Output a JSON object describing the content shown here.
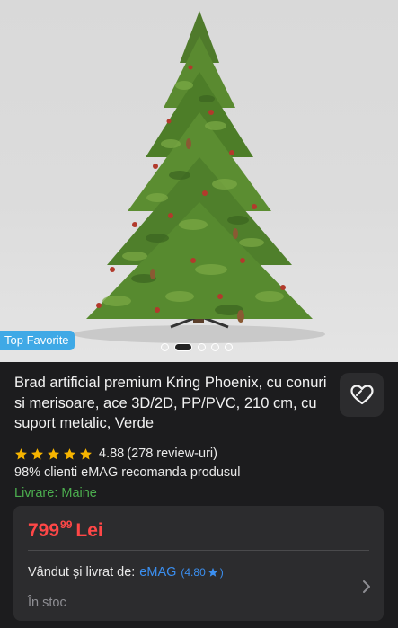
{
  "gallery": {
    "badge": "Top Favorite",
    "slide_count": 5,
    "active_slide": 2
  },
  "product": {
    "title": "Brad artificial premium Kring Phoenix, cu conuri si merisoare, ace 3D/2D, PP/PVC, 210 cm, cu suport metalic, Verde",
    "rating_value": "4.88",
    "review_count": "(278 review-uri)",
    "stars": 5,
    "recommend_text": "98% clienti eMAG recomanda produsul",
    "delivery_text": "Livrare: Maine"
  },
  "offer": {
    "price_integer": "799",
    "price_decimals": "99",
    "currency": "Lei",
    "seller_label": "Vândut și livrat de:",
    "seller_name": "eMAG",
    "seller_rating": "(4.80",
    "seller_rating_close": ")",
    "stock_text": "În stoc"
  },
  "colors": {
    "background": "#1c1c1e",
    "card": "#2c2c2e",
    "price": "#ff4747",
    "delivery": "#4cae4f",
    "link": "#3b8ff0",
    "badge": "#3fa9e6",
    "star": "#f6b400"
  },
  "icons": {
    "favorite": "heart-outline-icon",
    "rating_star": "star-icon",
    "chevron": "chevron-right-icon"
  }
}
